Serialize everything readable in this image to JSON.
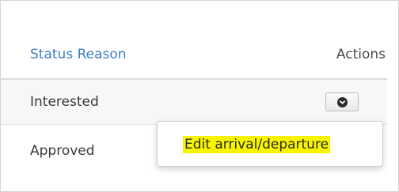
{
  "table": {
    "columns": {
      "status_reason": "Status Reason",
      "actions": "Actions"
    },
    "rows": [
      {
        "status_reason": "Interested"
      },
      {
        "status_reason": "Approved"
      }
    ]
  },
  "dropdown": {
    "items": [
      {
        "label": "Edit arrival/departure",
        "highlighted": true
      }
    ]
  },
  "colors": {
    "header_link": "#3f7cc4",
    "highlight": "#f8f400",
    "row_alt_bg": "#f7f7f7"
  },
  "icons": {
    "actions_button": "chevron-down-circle-icon"
  }
}
